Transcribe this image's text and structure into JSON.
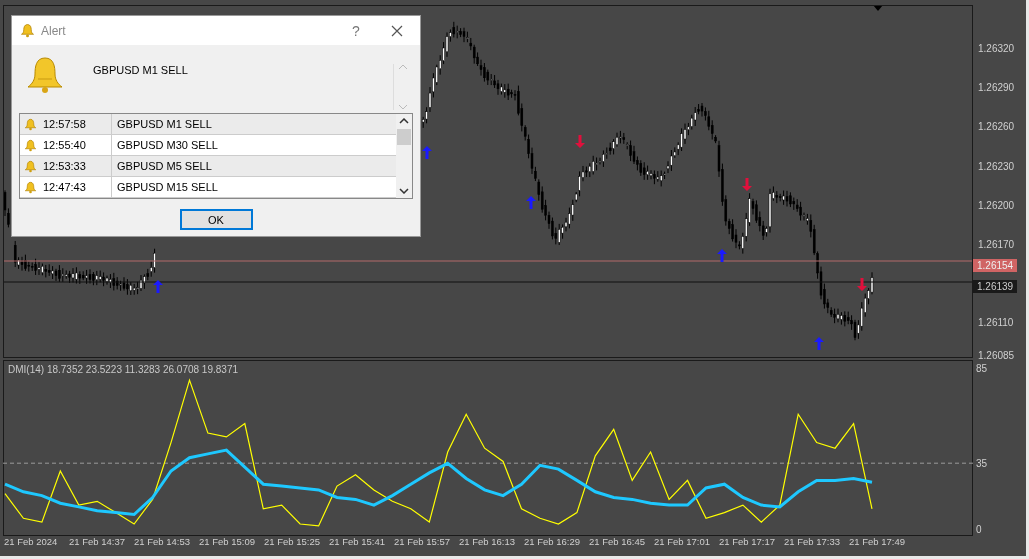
{
  "dialog": {
    "title": "Alert",
    "help": "?",
    "message": "GBPUSD M1 SELL",
    "history": [
      {
        "time": "12:57:58",
        "text": "GBPUSD M1 SELL"
      },
      {
        "time": "12:55:40",
        "text": "GBPUSD M30 SELL"
      },
      {
        "time": "12:53:33",
        "text": "GBPUSD M5 SELL"
      },
      {
        "time": "12:47:43",
        "text": "GBPUSD M15 SELL"
      }
    ],
    "ok": "OK"
  },
  "price_axis": [
    "1.26320",
    "1.26290",
    "1.26260",
    "1.26230",
    "1.26200",
    "1.26170",
    "1.26110",
    "1.26085"
  ],
  "price_markers": [
    {
      "kind": "ask",
      "text": "1.26154"
    },
    {
      "kind": "bid",
      "text": "1.26139"
    }
  ],
  "indicator": {
    "title": "DMI(14) 18.7352 23.5223 11.3283 26.0708 19.8371",
    "chart_data": {
      "type": "line",
      "ylim": [
        -4.5,
        89.5
      ],
      "yticks": [
        0,
        35,
        85
      ],
      "series": [
        {
          "color": "#ffff00",
          "values": [
            18,
            5,
            3,
            30,
            12,
            14,
            8,
            2,
            15,
            45,
            78,
            50,
            48,
            55,
            10,
            12,
            2,
            1,
            22,
            28,
            20,
            14,
            10,
            3,
            40,
            60,
            42,
            35,
            10,
            5,
            2,
            8,
            38,
            52,
            25,
            40,
            15,
            25,
            5,
            8,
            12,
            3,
            12,
            60,
            45,
            42,
            55,
            10
          ]
        },
        {
          "color": "#1ec8ff",
          "values": [
            23,
            19,
            17,
            13,
            11,
            9,
            8,
            7,
            16,
            30,
            37,
            39,
            41,
            32,
            23,
            22,
            21,
            20,
            16,
            15,
            12,
            17,
            23,
            29,
            34,
            26,
            20,
            17,
            23,
            33,
            31,
            25,
            19,
            16,
            15,
            13,
            12,
            12,
            21,
            23,
            16,
            12,
            11,
            19,
            25,
            25,
            26,
            24
          ]
        }
      ]
    }
  },
  "time_axis": [
    "21 Feb 2024",
    "21 Feb 14:37",
    "21 Feb 14:53",
    "21 Feb 15:09",
    "21 Feb 15:25",
    "21 Feb 15:41",
    "21 Feb 15:57",
    "21 Feb 16:13",
    "21 Feb 16:29",
    "21 Feb 16:45",
    "21 Feb 17:01",
    "21 Feb 17:17",
    "21 Feb 17:33",
    "21 Feb 17:49"
  ]
}
